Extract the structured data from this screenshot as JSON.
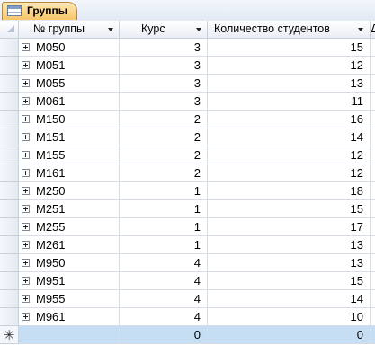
{
  "tab": {
    "icon": "table-icon",
    "title": "Группы"
  },
  "columns": {
    "group": "№ группы",
    "course": "Курс",
    "count": "Количество студентов",
    "extra": "Д"
  },
  "rows": [
    {
      "group": "M050",
      "course": "3",
      "count": "15"
    },
    {
      "group": "M051",
      "course": "3",
      "count": "12"
    },
    {
      "group": "M055",
      "course": "3",
      "count": "13"
    },
    {
      "group": "M061",
      "course": "3",
      "count": "11"
    },
    {
      "group": "M150",
      "course": "2",
      "count": "16"
    },
    {
      "group": "M151",
      "course": "2",
      "count": "14"
    },
    {
      "group": "M155",
      "course": "2",
      "count": "12"
    },
    {
      "group": "M161",
      "course": "2",
      "count": "12"
    },
    {
      "group": "M250",
      "course": "1",
      "count": "18"
    },
    {
      "group": "M251",
      "course": "1",
      "count": "15"
    },
    {
      "group": "M255",
      "course": "1",
      "count": "17"
    },
    {
      "group": "M261",
      "course": "1",
      "count": "13"
    },
    {
      "group": "M950",
      "course": "4",
      "count": "13"
    },
    {
      "group": "M951",
      "course": "4",
      "count": "15"
    },
    {
      "group": "M955",
      "course": "4",
      "count": "14"
    },
    {
      "group": "M961",
      "course": "4",
      "count": "10"
    }
  ],
  "new_row": {
    "marker": "✳",
    "course": "0",
    "count": "0"
  }
}
